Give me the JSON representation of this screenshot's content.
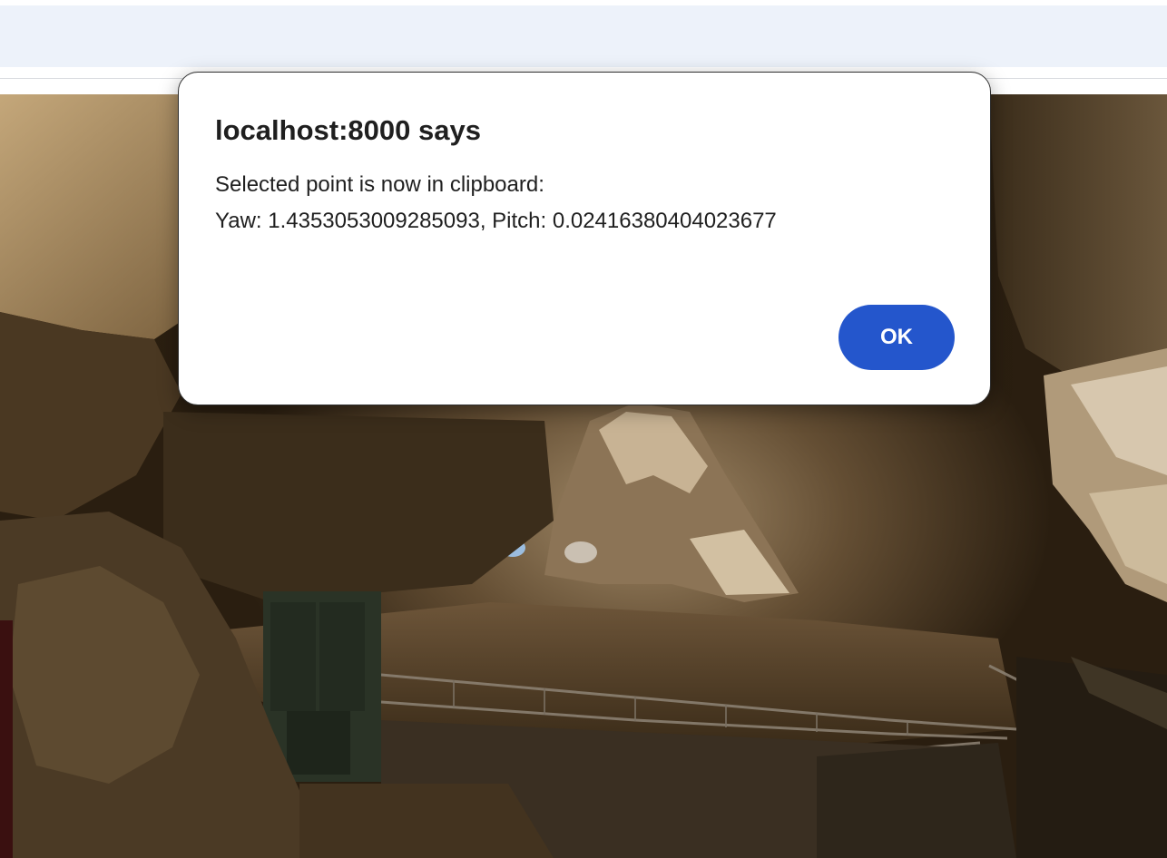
{
  "browser": {
    "toolbar_color": "#edf2fa"
  },
  "dialog": {
    "title": "localhost:8000 says",
    "message_line1": "Selected point is now in clipboard:",
    "message_line2": "Yaw: 1.4353053009285093, Pitch: 0.02416380404023677",
    "ok_label": "OK",
    "ok_color": "#2456cc"
  },
  "viewer": {
    "scene": "cave-panorama"
  }
}
